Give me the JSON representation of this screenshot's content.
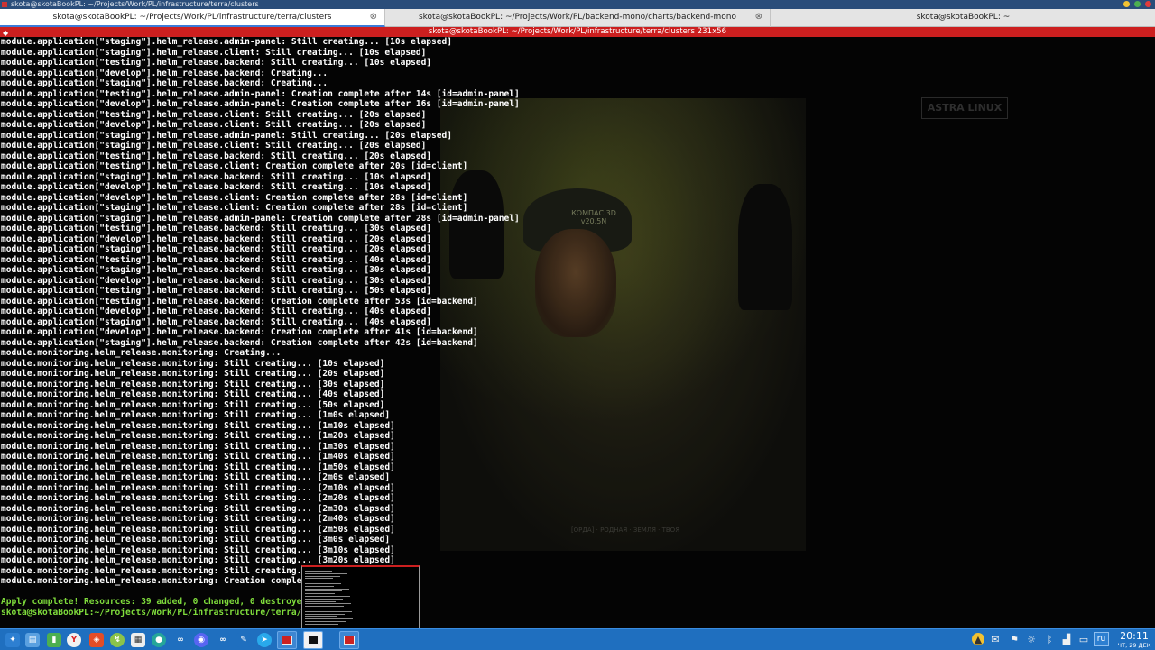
{
  "window": {
    "title": "skota@skotaBookPL: ~/Projects/Work/PL/infrastructure/terra/clusters"
  },
  "tabs": [
    {
      "label": "skota@skotaBookPL: ~/Projects/Work/PL/infrastructure/terra/clusters",
      "active": true
    },
    {
      "label": "skota@skotaBookPL: ~/Projects/Work/PL/backend-mono/charts/backend-mono",
      "active": false
    },
    {
      "label": "skota@skotaBookPL: ~",
      "active": false
    }
  ],
  "terminal_header": "skota@skotaBookPL: ~/Projects/Work/PL/infrastructure/terra/clusters 231x56",
  "wallpaper": {
    "badge": "КОМПАС 3D v20.5N",
    "corner_logo": "ASTRA LINUX",
    "caption": "[ОРДА] · РОДНАЯ · ЗЕМЛЯ · ТВОЯ"
  },
  "lines": [
    "module.application[\"staging\"].helm_release.admin-panel: Still creating... [10s elapsed]",
    "module.application[\"staging\"].helm_release.client: Still creating... [10s elapsed]",
    "module.application[\"testing\"].helm_release.backend: Still creating... [10s elapsed]",
    "module.application[\"develop\"].helm_release.backend: Creating...",
    "module.application[\"staging\"].helm_release.backend: Creating...",
    "module.application[\"testing\"].helm_release.admin-panel: Creation complete after 14s [id=admin-panel]",
    "module.application[\"develop\"].helm_release.admin-panel: Creation complete after 16s [id=admin-panel]",
    "module.application[\"testing\"].helm_release.client: Still creating... [20s elapsed]",
    "module.application[\"develop\"].helm_release.client: Still creating... [20s elapsed]",
    "module.application[\"staging\"].helm_release.admin-panel: Still creating... [20s elapsed]",
    "module.application[\"staging\"].helm_release.client: Still creating... [20s elapsed]",
    "module.application[\"testing\"].helm_release.backend: Still creating... [20s elapsed]",
    "module.application[\"testing\"].helm_release.client: Creation complete after 20s [id=client]",
    "module.application[\"staging\"].helm_release.backend: Still creating... [10s elapsed]",
    "module.application[\"develop\"].helm_release.backend: Still creating... [10s elapsed]",
    "module.application[\"develop\"].helm_release.client: Creation complete after 28s [id=client]",
    "module.application[\"staging\"].helm_release.client: Creation complete after 28s [id=client]",
    "module.application[\"staging\"].helm_release.admin-panel: Creation complete after 28s [id=admin-panel]",
    "module.application[\"testing\"].helm_release.backend: Still creating... [30s elapsed]",
    "module.application[\"develop\"].helm_release.backend: Still creating... [20s elapsed]",
    "module.application[\"staging\"].helm_release.backend: Still creating... [20s elapsed]",
    "module.application[\"testing\"].helm_release.backend: Still creating... [40s elapsed]",
    "module.application[\"staging\"].helm_release.backend: Still creating... [30s elapsed]",
    "module.application[\"develop\"].helm_release.backend: Still creating... [30s elapsed]",
    "module.application[\"testing\"].helm_release.backend: Still creating... [50s elapsed]",
    "module.application[\"testing\"].helm_release.backend: Creation complete after 53s [id=backend]",
    "module.application[\"develop\"].helm_release.backend: Still creating... [40s elapsed]",
    "module.application[\"staging\"].helm_release.backend: Still creating... [40s elapsed]",
    "module.application[\"develop\"].helm_release.backend: Creation complete after 41s [id=backend]",
    "module.application[\"staging\"].helm_release.backend: Creation complete after 42s [id=backend]",
    "module.monitoring.helm_release.monitoring: Creating...",
    "module.monitoring.helm_release.monitoring: Still creating... [10s elapsed]",
    "module.monitoring.helm_release.monitoring: Still creating... [20s elapsed]",
    "module.monitoring.helm_release.monitoring: Still creating... [30s elapsed]",
    "module.monitoring.helm_release.monitoring: Still creating... [40s elapsed]",
    "module.monitoring.helm_release.monitoring: Still creating... [50s elapsed]",
    "module.monitoring.helm_release.monitoring: Still creating... [1m0s elapsed]",
    "module.monitoring.helm_release.monitoring: Still creating... [1m10s elapsed]",
    "module.monitoring.helm_release.monitoring: Still creating... [1m20s elapsed]",
    "module.monitoring.helm_release.monitoring: Still creating... [1m30s elapsed]",
    "module.monitoring.helm_release.monitoring: Still creating... [1m40s elapsed]",
    "module.monitoring.helm_release.monitoring: Still creating... [1m50s elapsed]",
    "module.monitoring.helm_release.monitoring: Still creating... [2m0s elapsed]",
    "module.monitoring.helm_release.monitoring: Still creating... [2m10s elapsed]",
    "module.monitoring.helm_release.monitoring: Still creating... [2m20s elapsed]",
    "module.monitoring.helm_release.monitoring: Still creating... [2m30s elapsed]",
    "module.monitoring.helm_release.monitoring: Still creating... [2m40s elapsed]",
    "module.monitoring.helm_release.monitoring: Still creating... [2m50s elapsed]",
    "module.monitoring.helm_release.monitoring: Still creating... [3m0s elapsed]",
    "module.monitoring.helm_release.monitoring: Still creating... [3m10s elapsed]",
    "module.monitoring.helm_release.monitoring: Still creating... [3m20s elapsed]",
    "module.monitoring.helm_release.monitoring: Still creating...",
    "module.monitoring.helm_release.monitoring: Creation complete"
  ],
  "apply_summary": "Apply complete! Resources: 39 added, 0 changed, 0 destroyed.",
  "prompt": "skota@skotaBookPL:~/Projects/Work/PL/infrastructure/terra/clu",
  "taskbar": {
    "language": "ru",
    "time": "20:11",
    "date": "ЧТ, 29 ДЕК"
  },
  "colors": {
    "terminal_bg": "#040404",
    "header_red": "#cc1f1f",
    "prompt_green": "#7fdc3c",
    "taskbar_blue": "#1f6fbf"
  }
}
